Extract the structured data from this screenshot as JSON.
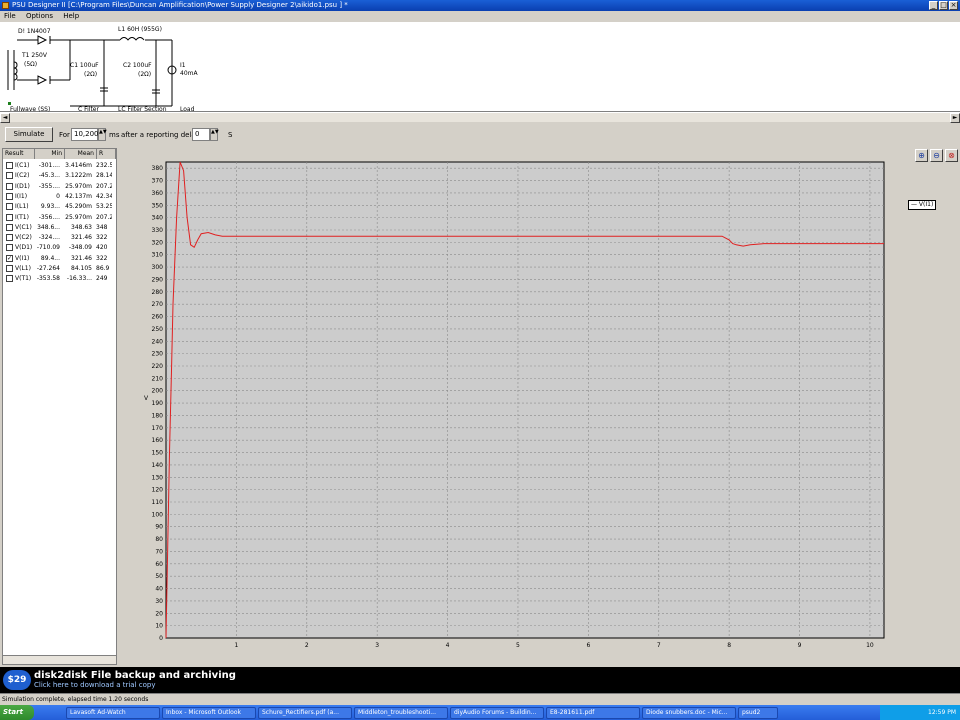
{
  "window": {
    "title": "PSU Designer II  [C:\\Program Files\\Duncan Amplification\\Power Supply Designer 2\\aikido1.psu ] *"
  },
  "menu": {
    "items": [
      "File",
      "Options",
      "Help"
    ]
  },
  "schematic": {
    "d1": "D! 1N4007",
    "l1": "L1 60H (955G)",
    "t1": "T1 250V",
    "t1r": "(5Ω)",
    "c1": "C1 100uF",
    "c1r": "(2Ω)",
    "c2": "C2 100uF",
    "c2r": "(2Ω)",
    "load": "I1",
    "loadv": "40mA",
    "sec1": "Fullwave (SS)",
    "sec2": "C Filter",
    "sec3": "LC Filter Section",
    "sec4": "Load"
  },
  "sim": {
    "button": "Simulate",
    "for_label": "For",
    "duration": "10,200",
    "ms_label": "ms",
    "delay_label": "after a reporting delay of",
    "delay": "0",
    "s_label": "S"
  },
  "results": {
    "headers": [
      "Result",
      "Min",
      "Mean",
      "R"
    ],
    "rows": [
      {
        "name": "I(C1)",
        "min": "-301....",
        "mean": "3.4146m",
        "r": "232.5",
        "checked": false
      },
      {
        "name": "I(C2)",
        "min": "-45.3...",
        "mean": "3.1222m",
        "r": "28.14",
        "checked": false
      },
      {
        "name": "I(D1)",
        "min": "-355....",
        "mean": "25.970m",
        "r": "207.2",
        "checked": false
      },
      {
        "name": "I(I1)",
        "min": "0",
        "mean": "42.137m",
        "r": "42.34",
        "checked": false
      },
      {
        "name": "I(L1)",
        "min": "9.93...",
        "mean": "45.290m",
        "r": "53.25",
        "checked": false
      },
      {
        "name": "I(T1)",
        "min": "-356....",
        "mean": "25.970m",
        "r": "207.2",
        "checked": false
      },
      {
        "name": "V(C1)",
        "min": "348.6...",
        "mean": "348.63",
        "r": "348",
        "checked": false
      },
      {
        "name": "V(C2)",
        "min": "-324....",
        "mean": "321.46",
        "r": "322",
        "checked": false
      },
      {
        "name": "V(D1)",
        "min": "-710.09",
        "mean": "-348.09",
        "r": "420",
        "checked": false
      },
      {
        "name": "V(I1)",
        "min": "89.4...",
        "mean": "321.46",
        "r": "322",
        "checked": true
      },
      {
        "name": "V(L1)",
        "min": "-27.264",
        "mean": "84.105",
        "r": "86.9",
        "checked": false
      },
      {
        "name": "V(T1)",
        "min": "-353.58",
        "mean": "-16.33...",
        "r": "249",
        "checked": false
      }
    ]
  },
  "chart_data": {
    "type": "line",
    "xlabel": "",
    "ylabel": "V",
    "xlim": [
      0,
      10.2
    ],
    "ylim": [
      0,
      385
    ],
    "xticks": [
      1,
      2,
      3,
      4,
      5,
      6,
      7,
      8,
      9,
      10
    ],
    "ytick_step": 10,
    "grid": true,
    "series": [
      {
        "name": "V(I1)",
        "color": "#e02020",
        "x": [
          0,
          0.02,
          0.05,
          0.08,
          0.1,
          0.15,
          0.2,
          0.25,
          0.3,
          0.35,
          0.4,
          0.45,
          0.5,
          0.6,
          0.7,
          0.8,
          1,
          2,
          4,
          6,
          7.9,
          8.0,
          8.05,
          8.1,
          8.2,
          8.3,
          8.5,
          9,
          10,
          10.2
        ],
        "y": [
          0,
          60,
          150,
          220,
          270,
          340,
          385,
          378,
          340,
          318,
          316,
          322,
          327,
          328,
          326,
          325,
          325,
          325,
          325,
          325,
          325,
          322,
          319,
          318,
          317,
          318,
          319,
          319,
          319,
          319
        ]
      }
    ],
    "legend": "top-right"
  },
  "ad": {
    "badge": "$29",
    "title": "disk2disk File backup and archiving",
    "subtitle": "Click here to download a trial copy"
  },
  "status": "Simulation complete, elapsed time 1.20 seconds",
  "taskbar": {
    "start": "Start",
    "items": [
      "Lavasoft Ad-Watch",
      "Inbox - Microsoft Outlook",
      "Schure_Rectifiers.pdf (a...",
      "Middleton_troubleshooti...",
      "diyAudio Forums - Buildin...",
      "E8-281611.pdf",
      "Diode snubbers.doc - Mic...",
      "psud2"
    ],
    "clock": "12:59 PM"
  },
  "colors": {
    "plot_bg": "#cccccc",
    "trace": "#e02020",
    "title_bar": "#1a5fd6"
  }
}
